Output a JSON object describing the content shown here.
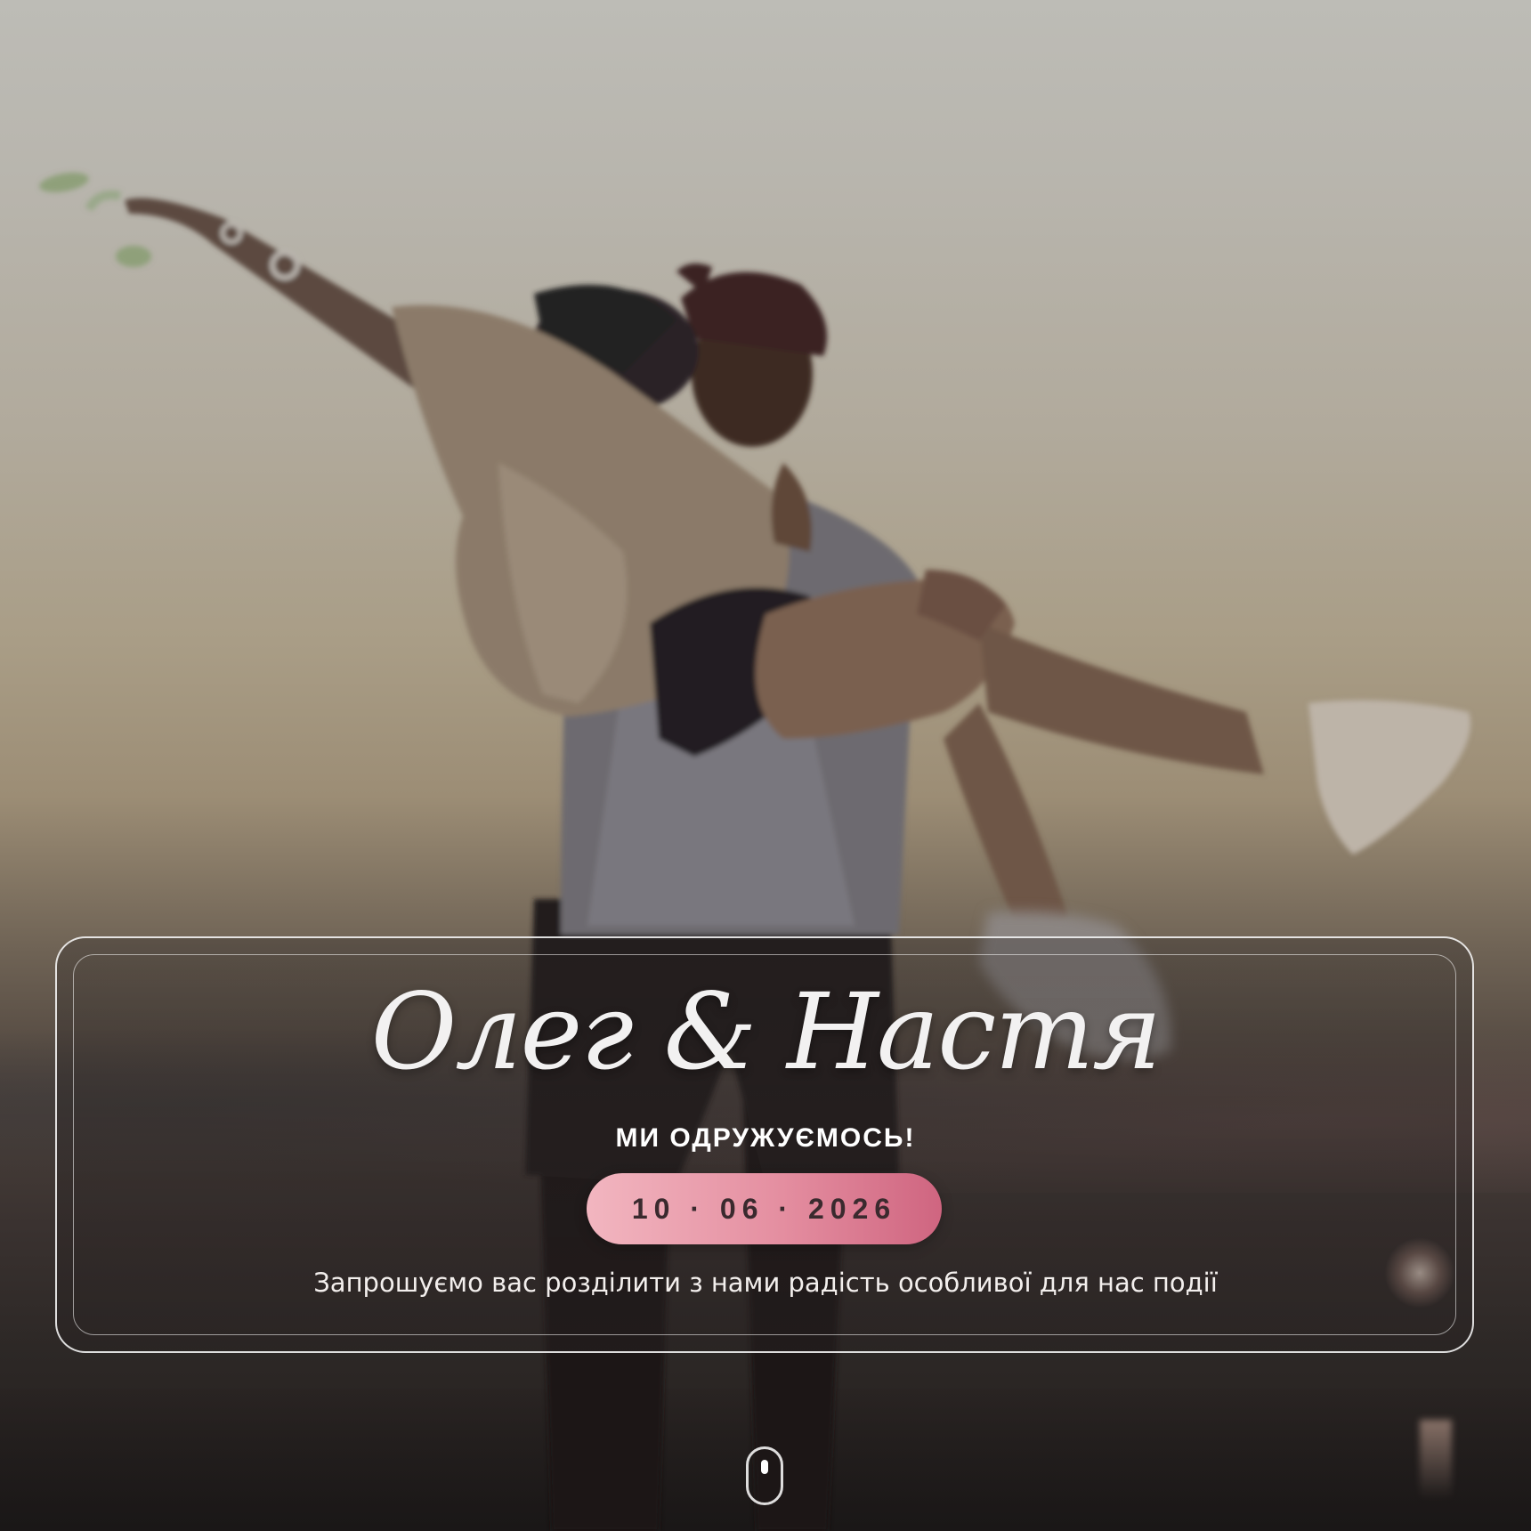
{
  "hero": {
    "names": "Олег & Настя",
    "subtitle": "МИ ОДРУЖУЄМОСЬ!",
    "date": "10 · 06 · 2026",
    "invitation": "Запрошуємо вас розділити з нами радість особливої для нас події"
  },
  "icons": {
    "scroll": "mouse-scroll-icon"
  },
  "colors": {
    "date_pill_start": "#f2b6c0",
    "date_pill_end": "#cf6580",
    "text_light": "#ffffff"
  }
}
